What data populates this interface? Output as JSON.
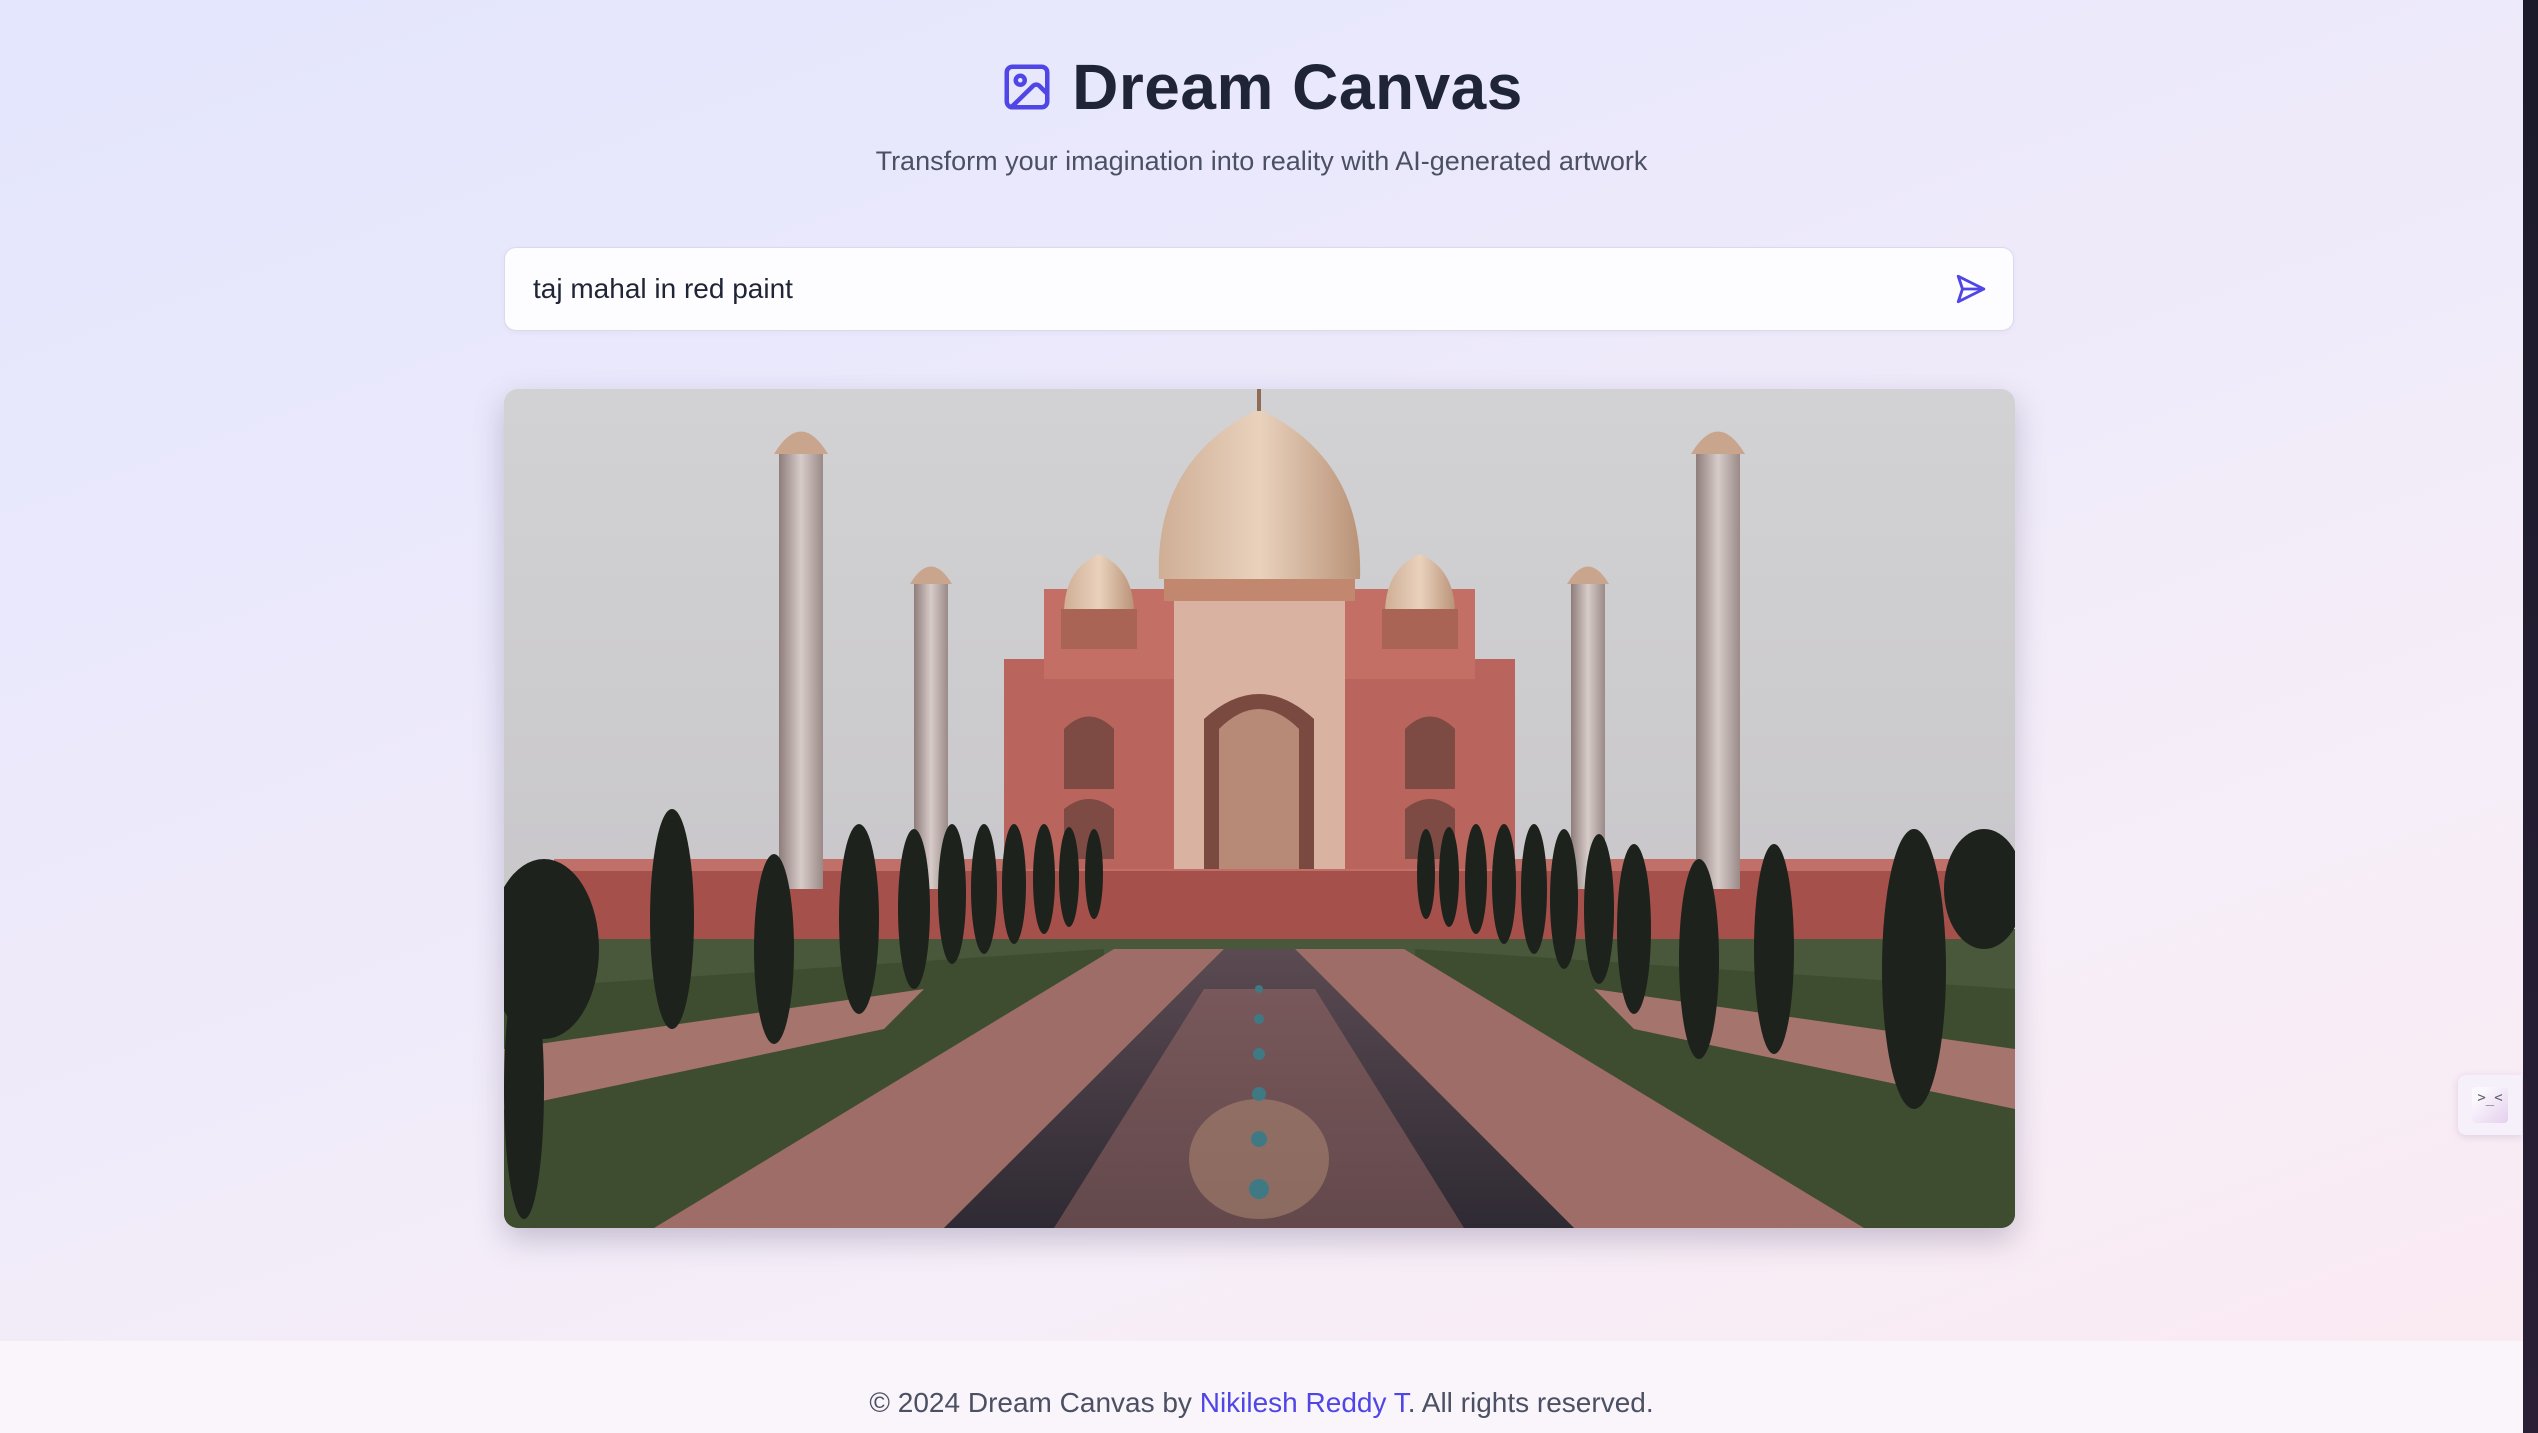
{
  "header": {
    "logo_icon": "image-icon",
    "title": "Dream Canvas",
    "subtitle": "Transform your imagination into reality with AI-generated artwork"
  },
  "prompt": {
    "value": "taj mahal in red paint",
    "send_icon": "send-icon"
  },
  "generated_image": {
    "alt": "taj mahal in red paint"
  },
  "side_widget": {
    "icon": "terminal-icon"
  },
  "footer": {
    "prefix": "© 2024 Dream Canvas by ",
    "author": "Nikilesh Reddy T",
    "suffix": ". All rights reserved."
  },
  "colors": {
    "accent": "#4f46e5",
    "title": "#1f2436",
    "text": "#4b5063"
  }
}
